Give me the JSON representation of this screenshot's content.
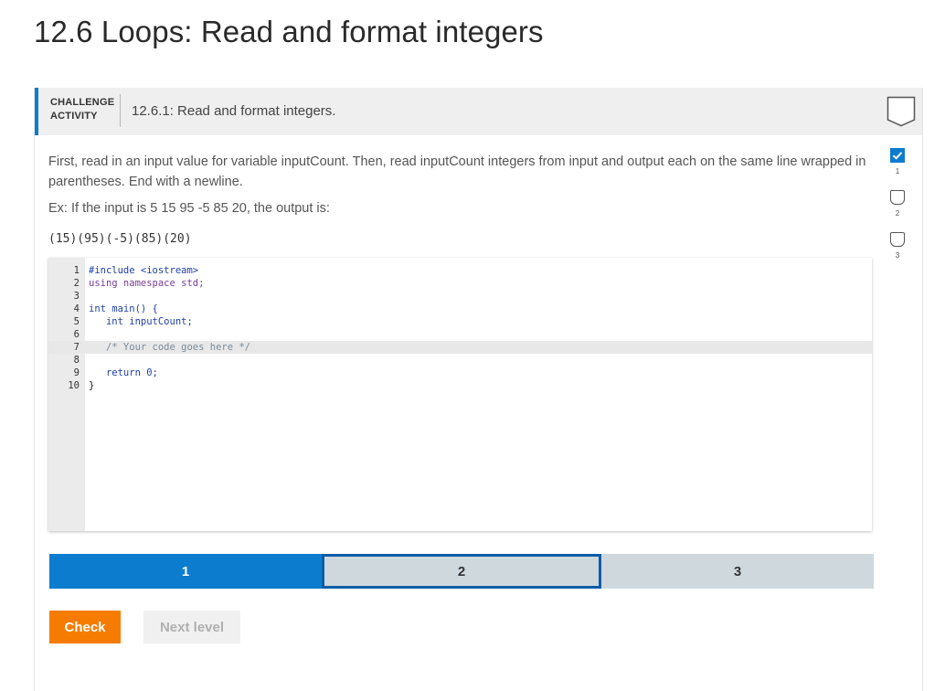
{
  "page": {
    "title": "12.6 Loops: Read and format integers"
  },
  "activity": {
    "type_label_line1": "CHALLENGE",
    "type_label_line2": "ACTIVITY",
    "title": "12.6.1: Read and format integers."
  },
  "prompt": {
    "text": "First, read in an input value for variable inputCount. Then, read inputCount integers from input and output each on the same line wrapped in parentheses. End with a newline.",
    "example": "Ex: If the input is 5 15 95 -5 85 20, the output is:",
    "expected_output": "(15)(95)(-5)(85)(20)"
  },
  "editor": {
    "lines": [
      {
        "n": "1",
        "text": "#include <iostream>"
      },
      {
        "n": "2",
        "text": "using namespace std;"
      },
      {
        "n": "3",
        "text": ""
      },
      {
        "n": "4",
        "text": "int main() {"
      },
      {
        "n": "5",
        "text": "   int inputCount;"
      },
      {
        "n": "6",
        "text": ""
      },
      {
        "n": "7",
        "text": "   /* Your code goes here */"
      },
      {
        "n": "8",
        "text": ""
      },
      {
        "n": "9",
        "text": "   return 0;"
      },
      {
        "n": "10",
        "text": "}"
      }
    ]
  },
  "levels": [
    {
      "label": "1",
      "state": "completed"
    },
    {
      "label": "2",
      "state": "current"
    },
    {
      "label": "3",
      "state": "locked"
    }
  ],
  "buttons": {
    "check": "Check",
    "next_level": "Next level"
  },
  "progress": [
    {
      "label": "1",
      "done": true
    },
    {
      "label": "2",
      "done": false
    },
    {
      "label": "3",
      "done": false
    }
  ],
  "colors": {
    "accent": "#0c7ccf",
    "check_button": "#f57c00",
    "level_inactive": "#cfd8dd"
  }
}
